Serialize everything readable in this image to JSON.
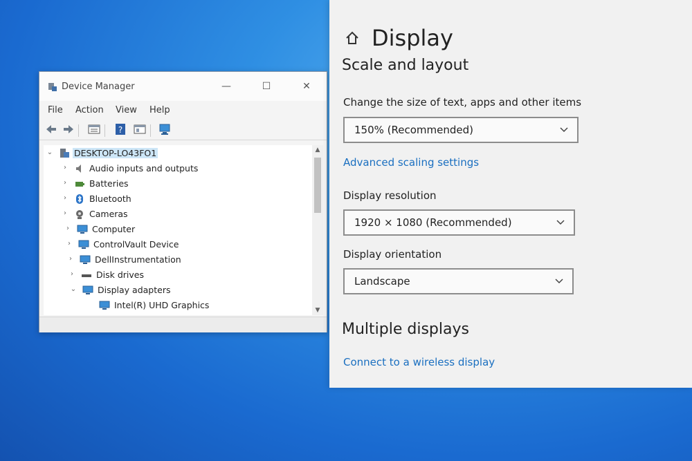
{
  "device_manager": {
    "title": "Device Manager",
    "window_controls": {
      "minimize": "—",
      "maximize": "☐",
      "close": "✕"
    },
    "menu": [
      "File",
      "Action",
      "View",
      "Help"
    ],
    "toolbar_icons": [
      "back-arrow-icon",
      "forward-arrow-icon",
      "properties-icon",
      "help-icon",
      "device-view-icon",
      "scan-hardware-icon"
    ],
    "tree": {
      "root": "DESKTOP-LO43FO1",
      "items": [
        {
          "label": "Audio inputs and outputs",
          "icon": "speaker-icon",
          "expanded": false
        },
        {
          "label": "Batteries",
          "icon": "battery-icon",
          "expanded": false
        },
        {
          "label": "Bluetooth",
          "icon": "bluetooth-icon",
          "expanded": false
        },
        {
          "label": "Cameras",
          "icon": "camera-icon",
          "expanded": false
        },
        {
          "label": "Computer",
          "icon": "computer-icon",
          "expanded": false
        },
        {
          "label": "ControlVault Device",
          "icon": "controlvault-icon",
          "expanded": false
        },
        {
          "label": "DellInstrumentation",
          "icon": "dell-instrumentation-icon",
          "expanded": false
        },
        {
          "label": "Disk drives",
          "icon": "disk-drive-icon",
          "expanded": false
        },
        {
          "label": "Display adapters",
          "icon": "display-adapter-icon",
          "expanded": true
        },
        {
          "label": "Intel(R) UHD Graphics",
          "icon": "display-adapter-icon",
          "child": true
        }
      ]
    }
  },
  "settings": {
    "page_title": "Display",
    "scale_section": "Scale and layout",
    "size_label": "Change the size of text, apps and other items",
    "size_value": "150% (Recommended)",
    "advanced_link": "Advanced scaling settings",
    "resolution_label": "Display resolution",
    "resolution_value": "1920 × 1080 (Recommended)",
    "orientation_label": "Display orientation",
    "orientation_value": "Landscape",
    "multiple_section": "Multiple displays",
    "wireless_link": "Connect to a wireless display"
  },
  "colors": {
    "link": "#1a6fc0",
    "desktop": "#2f8fe3",
    "selection": "#cde6f7"
  }
}
